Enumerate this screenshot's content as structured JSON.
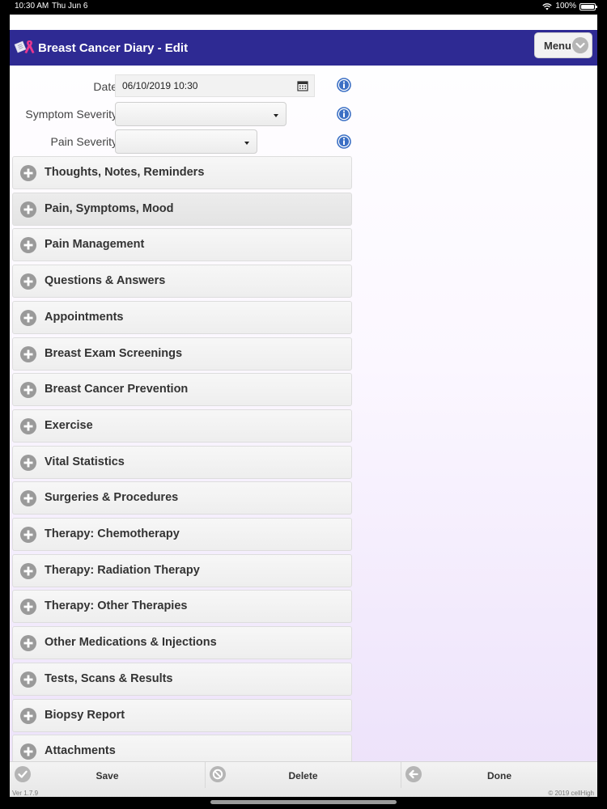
{
  "status_bar": {
    "time": "10:30 AM",
    "date": "Thu Jun 6",
    "battery": "100%",
    "icons": [
      "wifi-icon",
      "battery-icon"
    ]
  },
  "header": {
    "title": "Breast Cancer Diary - Edit",
    "menu_label": "Menu",
    "logo_icon": "ribbon-book-icon"
  },
  "form": {
    "date_label": "Date",
    "date_value": "06/10/2019 10:30",
    "symptom_label": "Symptom Severity",
    "symptom_value": "",
    "pain_label": "Pain Severity",
    "pain_value": ""
  },
  "sections": [
    "Thoughts, Notes, Reminders",
    "Pain, Symptoms, Mood",
    "Pain Management",
    "Questions & Answers",
    "Appointments",
    "Breast Exam Screenings",
    "Breast Cancer Prevention",
    "Exercise",
    "Vital Statistics",
    "Surgeries & Procedures",
    "Therapy: Chemotherapy",
    "Therapy: Radiation Therapy",
    "Therapy: Other Therapies",
    "Other Medications & Injections",
    "Tests, Scans & Results",
    "Biopsy Report",
    "Attachments"
  ],
  "footer": {
    "save_label": "Save",
    "delete_label": "Delete",
    "done_label": "Done",
    "version": "Ver 1.7.9",
    "copyright": "© 2019 cellHigh"
  },
  "colors": {
    "header_bg": "#2e2a93",
    "info_icon": "#3b6fc4",
    "plus_icon": "#9a9a9a"
  }
}
